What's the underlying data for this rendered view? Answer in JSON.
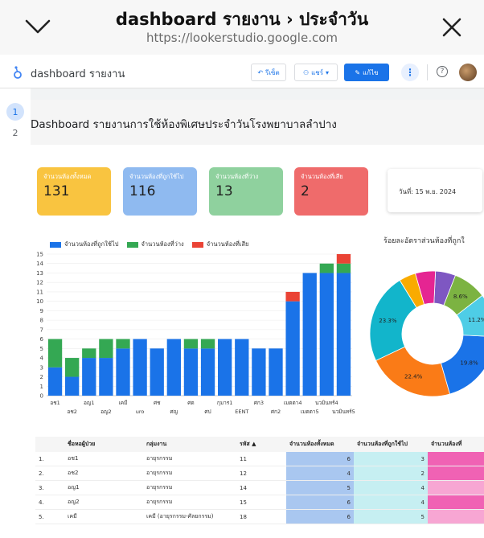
{
  "browser": {
    "title": "dashboard รายงาน › ประจำวัน",
    "url": "https://lookerstudio.google.com"
  },
  "toolbar": {
    "report_name": "dashboard รายงาน",
    "reset_label": "รีเซ็ต",
    "share_label": "แชร์",
    "edit_label": "แก้ไข"
  },
  "pages": [
    "1",
    "2"
  ],
  "report": {
    "title": "Dashboard รายงานการใช้ห้องพิเศษประจำวันโรงพยาบาลลำปาง",
    "kpis": [
      {
        "label": "จำนวนห้องทั้งหมด",
        "value": "131",
        "color": "#f9c440"
      },
      {
        "label": "จำนวนห้องที่ถูกใช้ไป",
        "value": "116",
        "color": "#8fbaf0"
      },
      {
        "label": "จำนวนห้องที่ว่าง",
        "value": "13",
        "color": "#8fd19e"
      },
      {
        "label": "จำนวนห้องที่เสีย",
        "value": "2",
        "color": "#ef6b6b"
      }
    ],
    "date_text": "วันที่: 15 พ.ย. 2024",
    "donut_title": "ร้อยละอัตราส่วนห้องที่ถูกใ"
  },
  "chart_data": [
    {
      "type": "bar",
      "stacked": true,
      "categories": [
        "อช1",
        "อช2",
        "อญ1",
        "อญ2",
        "เคมี",
        "uro",
        "ศช",
        "ศญ",
        "ศต",
        "ศป",
        "กุมาร1",
        "EENT",
        "ศก3",
        "ศก2",
        "เมตตา4",
        "เมตตา5",
        "นวมินทร์4",
        "นวมินทร์5"
      ],
      "tick_labels_row1": [
        "อช1",
        "",
        "อญ1",
        "",
        "เคมี",
        "",
        "ศช",
        "",
        "ศต",
        "",
        "กุมาร1",
        "",
        "ศก3",
        "",
        "เมตตา4",
        "",
        "นวมินทร์4",
        ""
      ],
      "tick_labels_row2": [
        "",
        "อช2",
        "",
        "อญ2",
        "",
        "uro",
        "",
        "ศญ",
        "",
        "ศป",
        "",
        "EENT",
        "",
        "ศก2",
        "",
        "เมตตา5",
        "",
        "นวมินทร์5"
      ],
      "series": [
        {
          "name": "จำนวนห้องที่ถูกใช้ไป",
          "color": "#1a73e8",
          "values": [
            3,
            2,
            4,
            4,
            5,
            6,
            5,
            6,
            5,
            5,
            6,
            6,
            5,
            5,
            10,
            13,
            13,
            13
          ]
        },
        {
          "name": "จำนวนห้องที่ว่าง",
          "color": "#34a853",
          "values": [
            3,
            2,
            1,
            2,
            1,
            0,
            0,
            0,
            1,
            1,
            0,
            0,
            0,
            0,
            0,
            0,
            1,
            1
          ]
        },
        {
          "name": "จำนวนห้องที่เสีย",
          "color": "#ea4335",
          "values": [
            0,
            0,
            0,
            0,
            0,
            0,
            0,
            0,
            0,
            0,
            0,
            0,
            0,
            0,
            1,
            0,
            0,
            1
          ]
        }
      ],
      "ylim": [
        0,
        15
      ],
      "yticks": [
        0,
        1,
        2,
        3,
        4,
        5,
        6,
        7,
        8,
        9,
        10,
        11,
        12,
        13,
        14,
        15
      ],
      "legend": "top-left",
      "grid": true
    },
    {
      "type": "pie",
      "donut": true,
      "title": "ร้อยละอัตราส่วนห้องที่ถูกใ",
      "slices": [
        {
          "value": 23.3,
          "color": "#12b5cb",
          "label": "23.3%"
        },
        {
          "value": 22.4,
          "color": "#fa7b17",
          "label": "22.4%"
        },
        {
          "value": 19.8,
          "color": "#1a73e8",
          "label": "19.8%"
        },
        {
          "value": 11.2,
          "color": "#4ecde6",
          "label": "11.2%"
        },
        {
          "value": 8.6,
          "color": "#7cb342",
          "label": "8.6%"
        },
        {
          "value": 5.2,
          "color": "#7e57c2",
          "label": ""
        },
        {
          "value": 5.2,
          "color": "#e52592",
          "label": ""
        },
        {
          "value": 4.3,
          "color": "#f9ab00",
          "label": ""
        }
      ]
    }
  ],
  "table": {
    "headers": [
      "",
      "ชื่อหอผู้ป่วย",
      "กลุ่มงาน",
      "รหัส ▲",
      "จำนวนห้องทั้งหมด",
      "จำนวนห้องที่ถูกใช้ไป",
      "จำนวนห้องที่"
    ],
    "rows": [
      [
        "1.",
        "อช1",
        "อายุรกรรม",
        "11",
        "6",
        "3"
      ],
      [
        "2.",
        "อช2",
        "อายุรกรรม",
        "12",
        "4",
        "2"
      ],
      [
        "3.",
        "อญ1",
        "อายุรกรรม",
        "14",
        "5",
        "4"
      ],
      [
        "4.",
        "อญ2",
        "อายุรกรรม",
        "15",
        "6",
        "4"
      ],
      [
        "5.",
        "เคมี",
        "เคมี (อายุรกรรม-ศัลยกรรม)",
        "18",
        "6",
        "5"
      ]
    ]
  }
}
